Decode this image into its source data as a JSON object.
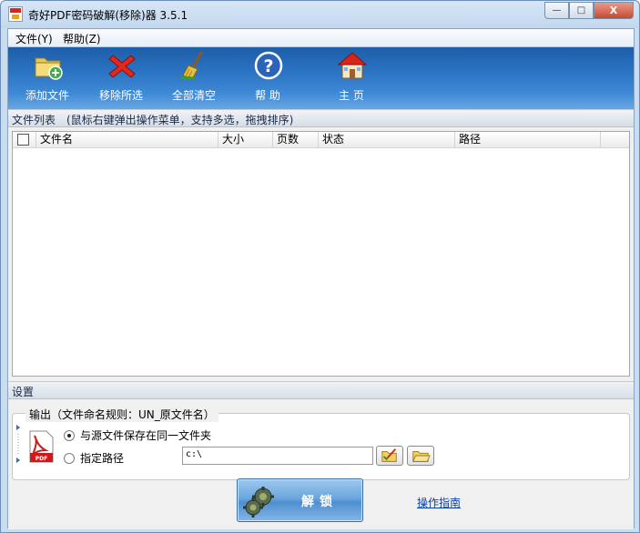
{
  "window": {
    "title": "奇好PDF密码破解(移除)器 3.5.1",
    "min_glyph": "—",
    "max_glyph": "□",
    "close_glyph": "X"
  },
  "menu": {
    "file": "文件(Y)",
    "help": "帮助(Z)"
  },
  "toolbar": {
    "add_file": "添加文件",
    "remove_selected": "移除所选",
    "clear_all": "全部清空",
    "help": "帮 助",
    "home": "主 页"
  },
  "file_list": {
    "title": "文件列表",
    "hint": "(鼠标右键弹出操作菜单，支持多选，拖拽排序)",
    "columns": [
      "文件名",
      "大小",
      "页数",
      "状态",
      "路径"
    ]
  },
  "settings": {
    "title": "设置",
    "output_group_title": "输出（文件命名规则：UN_原文件名）",
    "option_same_folder": "与源文件保存在同一文件夹",
    "option_custom_path": "指定路径",
    "path_value": "c:\\"
  },
  "actions": {
    "unlock": "解锁",
    "guide": "操作指南"
  },
  "colors": {
    "toolbar_top": "#1d5ea8",
    "toolbar_bottom": "#6aa7e2",
    "link": "#0a3ea8"
  }
}
